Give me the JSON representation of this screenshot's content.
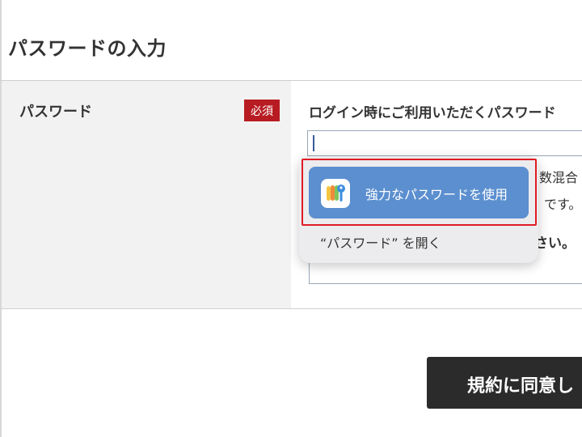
{
  "section": {
    "title": "パスワードの入力"
  },
  "form": {
    "field_label": "パスワード",
    "required_badge": "必須",
    "instruction": "ログイン時にご利用いただくパスワード",
    "hints": [
      "数混合",
      "です。",
      "さい。"
    ]
  },
  "autofill": {
    "strong_password_label": "強力なパスワードを使用",
    "strong_password_icon": "keys-icon",
    "open_passwords_label": "“パスワード” を開く"
  },
  "agree_button": {
    "label": "規約に同意し"
  },
  "colors": {
    "required_badge": "#b81c22",
    "popover_selected": "#5b8fcf",
    "highlight": "#e01b24",
    "agree_button": "#2b2b2b"
  }
}
